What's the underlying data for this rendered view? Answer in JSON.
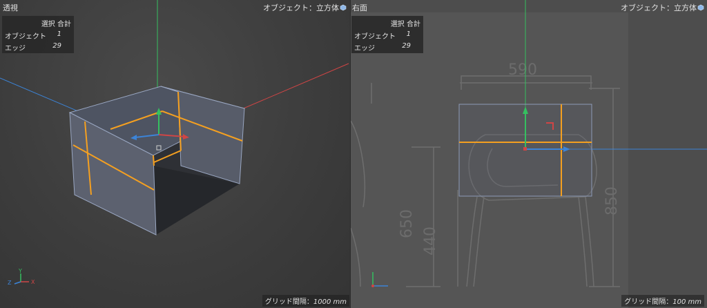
{
  "viewports": {
    "left": {
      "title": "透視",
      "object_label": "オブジェクト：立方体",
      "selection": {
        "header": "選択 合計",
        "rows": [
          {
            "label": "オブジェクト",
            "value": "1"
          },
          {
            "label": "エッジ",
            "value": "29"
          }
        ]
      },
      "grid_label": "グリッド間隔：",
      "grid_value": "1000 mm",
      "gizmo": {
        "x": "X",
        "y": "Y",
        "z": "Z"
      }
    },
    "right": {
      "title": "右面",
      "object_label": "オブジェクト：立方体",
      "selection": {
        "header": "選択 合計",
        "rows": [
          {
            "label": "オブジェクト",
            "value": "1"
          },
          {
            "label": "エッジ",
            "value": "29"
          }
        ]
      },
      "grid_label": "グリッド間隔：",
      "grid_value": "100 mm",
      "dimensions": {
        "width": "590",
        "height_total": "850",
        "height_a": "650",
        "height_b": "440"
      }
    }
  },
  "colors": {
    "selected_edge": "#f5a020",
    "axis_x": "#d04545",
    "axis_y": "#35c060",
    "axis_z": "#3c84d8",
    "cube_face": "#5a5f6c",
    "cube_inner": "#2c2e33"
  }
}
